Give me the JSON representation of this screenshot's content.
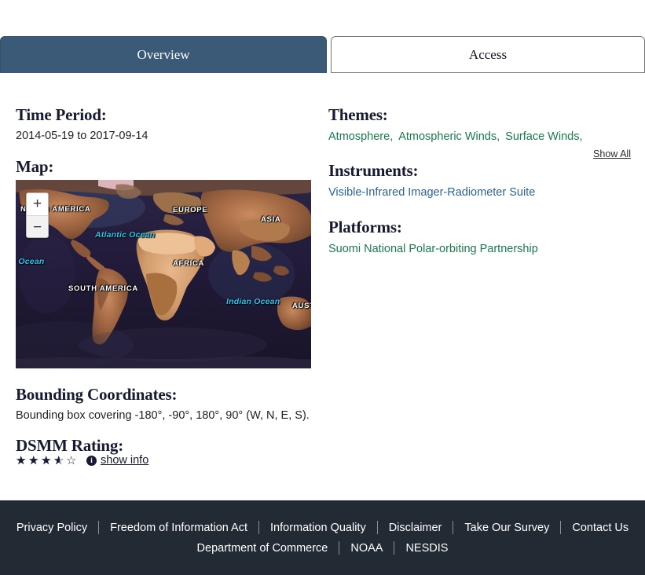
{
  "tabs": [
    {
      "label": "Overview",
      "active": true
    },
    {
      "label": "Access",
      "active": false
    }
  ],
  "left": {
    "time_period": {
      "heading": "Time Period:",
      "value": "2014-05-19 to 2017-09-14"
    },
    "map": {
      "heading": "Map:",
      "zoom_in_label": "+",
      "zoom_out_label": "−",
      "labels": [
        {
          "text": "NORTH AMERICA",
          "type": "land"
        },
        {
          "text": "SOUTH AMERICA",
          "type": "land"
        },
        {
          "text": "EUROPE",
          "type": "land"
        },
        {
          "text": "AFRICA",
          "type": "land"
        },
        {
          "text": "ASIA",
          "type": "land"
        },
        {
          "text": "AUSTRALIA",
          "type": "land"
        },
        {
          "text": "Atlantic Ocean",
          "type": "ocean"
        },
        {
          "text": "Indian Ocean",
          "type": "ocean"
        },
        {
          "text": "Pacific Ocean",
          "type": "ocean"
        }
      ]
    },
    "bounding": {
      "heading": "Bounding Coordinates:",
      "value": "Bounding box covering -180°, -90°, 180°, 90° (W, N, E, S)."
    },
    "dsmm": {
      "heading": "DSMM Rating:",
      "rating": 3.5,
      "max": 5,
      "info_icon": "info-icon",
      "show_info_label": "show info"
    }
  },
  "right": {
    "themes": {
      "heading": "Themes:",
      "items": [
        "Atmosphere,",
        "Atmospheric Winds,",
        "Surface Winds,"
      ],
      "show_all_label": "Show All"
    },
    "instruments": {
      "heading": "Instruments:",
      "items": [
        "Visible-Infrared Imager-Radiometer Suite"
      ]
    },
    "platforms": {
      "heading": "Platforms:",
      "items": [
        "Suomi National Polar-orbiting Partnership"
      ]
    }
  },
  "footer": {
    "row1": [
      "Privacy Policy",
      "Freedom of Information Act",
      "Information Quality",
      "Disclaimer",
      "Take Our Survey",
      "Contact Us"
    ],
    "row2": [
      "Department of Commerce",
      "NOAA",
      "NESDIS"
    ]
  },
  "colors": {
    "tab_active_bg": "#3a5a78",
    "theme_link": "#197a4c",
    "instrument_link": "#2a6496",
    "heading": "#171a33",
    "footer_bg": "#222a33",
    "ocean_label": "#29c7f2"
  }
}
